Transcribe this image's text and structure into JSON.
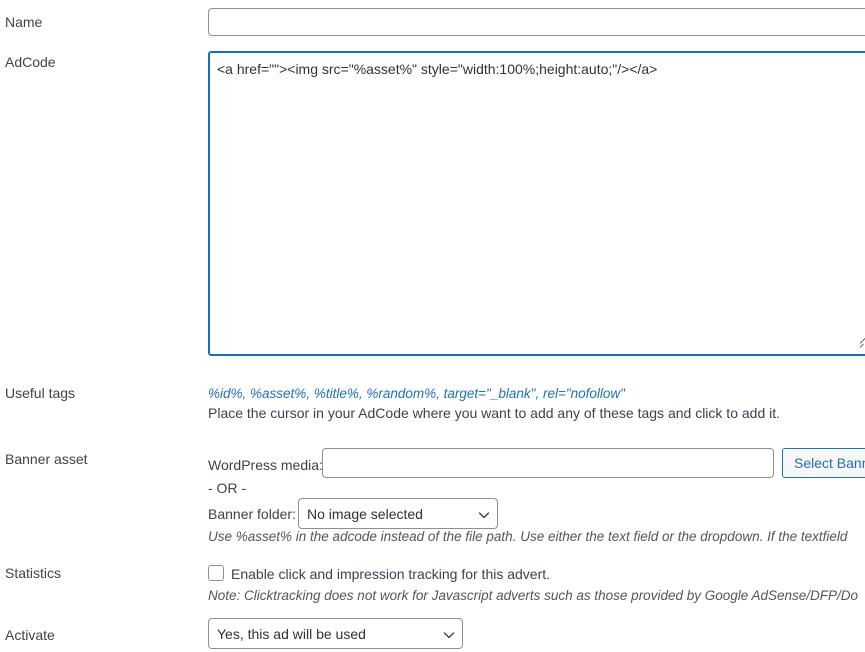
{
  "form": {
    "labels": {
      "name": "Name",
      "adcode": "AdCode",
      "useful_tags": "Useful tags",
      "banner_asset": "Banner asset",
      "statistics": "Statistics",
      "activate": "Activate"
    },
    "name_field": {
      "value": "",
      "placeholder": ""
    },
    "adcode_field": {
      "value": "<a href=\"\"><img src=\"%asset%\" style=\"width:100%;height:auto;\"/></a>",
      "cursor_after": "<a href=\""
    },
    "useful_tags": {
      "tags": [
        "%id%",
        "%asset%",
        "%title%",
        "%random%",
        "target=\"_blank\"",
        "rel=\"nofollow\""
      ],
      "separator": ", ",
      "hint": "Place the cursor in your AdCode where you want to add any of these tags and click to add it.",
      "link_color": "#2271b1"
    },
    "banner_asset": {
      "wordpress_media_label": "WordPress media:",
      "wordpress_media_value": "",
      "select_banner_button": "Select Banner",
      "or_text": "- OR -",
      "banner_folder_label": "Banner folder:",
      "banner_folder_value": "No image selected",
      "banner_folder_options": [
        "No image selected"
      ],
      "help": "Use %asset% in the adcode instead of the file path. Use either the text field or the dropdown. If the textfield"
    },
    "statistics": {
      "checkbox_label": "Enable click and impression tracking for this advert.",
      "checked": false,
      "note": "Note: Clicktracking does not work for Javascript adverts such as those provided by Google AdSense/DFP/Do"
    },
    "activate": {
      "value": "Yes, this ad will be used",
      "options": [
        "Yes, this ad will be used"
      ]
    },
    "icons": {
      "chevron_down": "chevron-down-icon",
      "resize_grip": "resize-grip-icon"
    },
    "colors": {
      "focus_border": "#1173b5",
      "link": "#2271b1",
      "text": "#3c434a",
      "input_border": "#8c8f94"
    }
  }
}
